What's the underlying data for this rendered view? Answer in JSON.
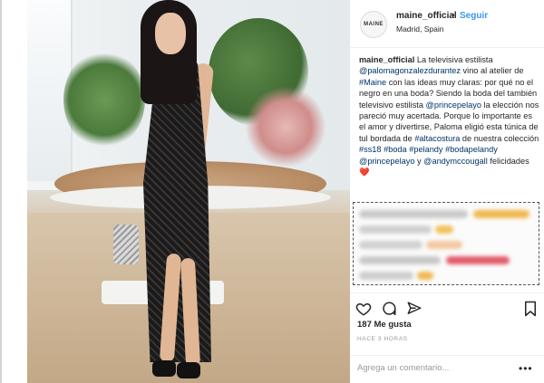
{
  "post": {
    "account": {
      "avatar_text": "MAINE",
      "username": "maine_official",
      "separator": "•",
      "follow_label": "Seguir",
      "location": "Madrid, Spain"
    },
    "caption": {
      "username": "maine_official",
      "segments": [
        {
          "t": " La televisiva estilista ",
          "m": false
        },
        {
          "t": "@palomagonzalezdurantez",
          "m": true
        },
        {
          "t": " vino al atelier de ",
          "m": false
        },
        {
          "t": "#Maine",
          "m": true
        },
        {
          "t": " con las ideas muy claras: por qué no el negro en una boda? Siendo la boda del también televisivo estilista ",
          "m": false
        },
        {
          "t": "@princepelayo",
          "m": true
        },
        {
          "t": " la elección nos pareció muy acertada. Porque lo importante es el amor y divertirse, Paloma eligió esta túnica de tul bordada de ",
          "m": false
        },
        {
          "t": "#altacostura",
          "m": true
        },
        {
          "t": " de nuestra colección ",
          "m": false
        },
        {
          "t": "#ss18",
          "m": true
        },
        {
          "t": " ",
          "m": false
        },
        {
          "t": "#boda",
          "m": true
        },
        {
          "t": " ",
          "m": false
        },
        {
          "t": "#pelandy",
          "m": true
        },
        {
          "t": " ",
          "m": false
        },
        {
          "t": "#bodapelandy",
          "m": true
        },
        {
          "t": " ",
          "m": false
        },
        {
          "t": "@princepelayo",
          "m": true
        },
        {
          "t": " y ",
          "m": false
        },
        {
          "t": "@andymccougall",
          "m": true
        },
        {
          "t": " felicidades ❤️",
          "m": false
        }
      ]
    },
    "actions": {
      "like_icon": "heart-icon",
      "comment_icon": "comment-bubble-icon",
      "share_icon": "share-icon",
      "save_icon": "bookmark-icon"
    },
    "likes_text": "187 Me gusta",
    "timestamp": "HACE 3 HORAS",
    "comment_placeholder": "Agrega un comentario...",
    "more_label": "•••",
    "colors": {
      "link": "#003569",
      "follow": "#3897f0",
      "text": "#262626",
      "muted": "#999999"
    }
  }
}
